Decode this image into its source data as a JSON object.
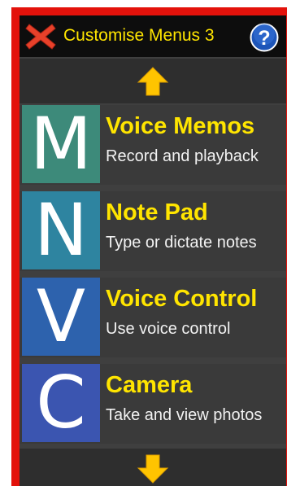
{
  "header": {
    "title": "Customise Menus 3",
    "close_icon": "close-x-icon",
    "help_icon": "help-question-icon",
    "help_glyph": "?"
  },
  "nav": {
    "up_icon": "arrow-up-icon",
    "down_icon": "arrow-down-icon"
  },
  "colors": {
    "frame": "#e3120b",
    "accent_text": "#ffe500",
    "tile_voice_memos": "#3d8a7a",
    "tile_note_pad": "#2e84a0",
    "tile_voice_control": "#2d62ad",
    "tile_camera": "#3b55b0"
  },
  "items": [
    {
      "letter": "M",
      "title": "Voice Memos",
      "subtitle": "Record and playback"
    },
    {
      "letter": "N",
      "title": "Note Pad",
      "subtitle": "Type or dictate notes"
    },
    {
      "letter": "V",
      "title": "Voice Control",
      "subtitle": "Use voice control"
    },
    {
      "letter": "C",
      "title": "Camera",
      "subtitle": "Take and view photos"
    }
  ]
}
